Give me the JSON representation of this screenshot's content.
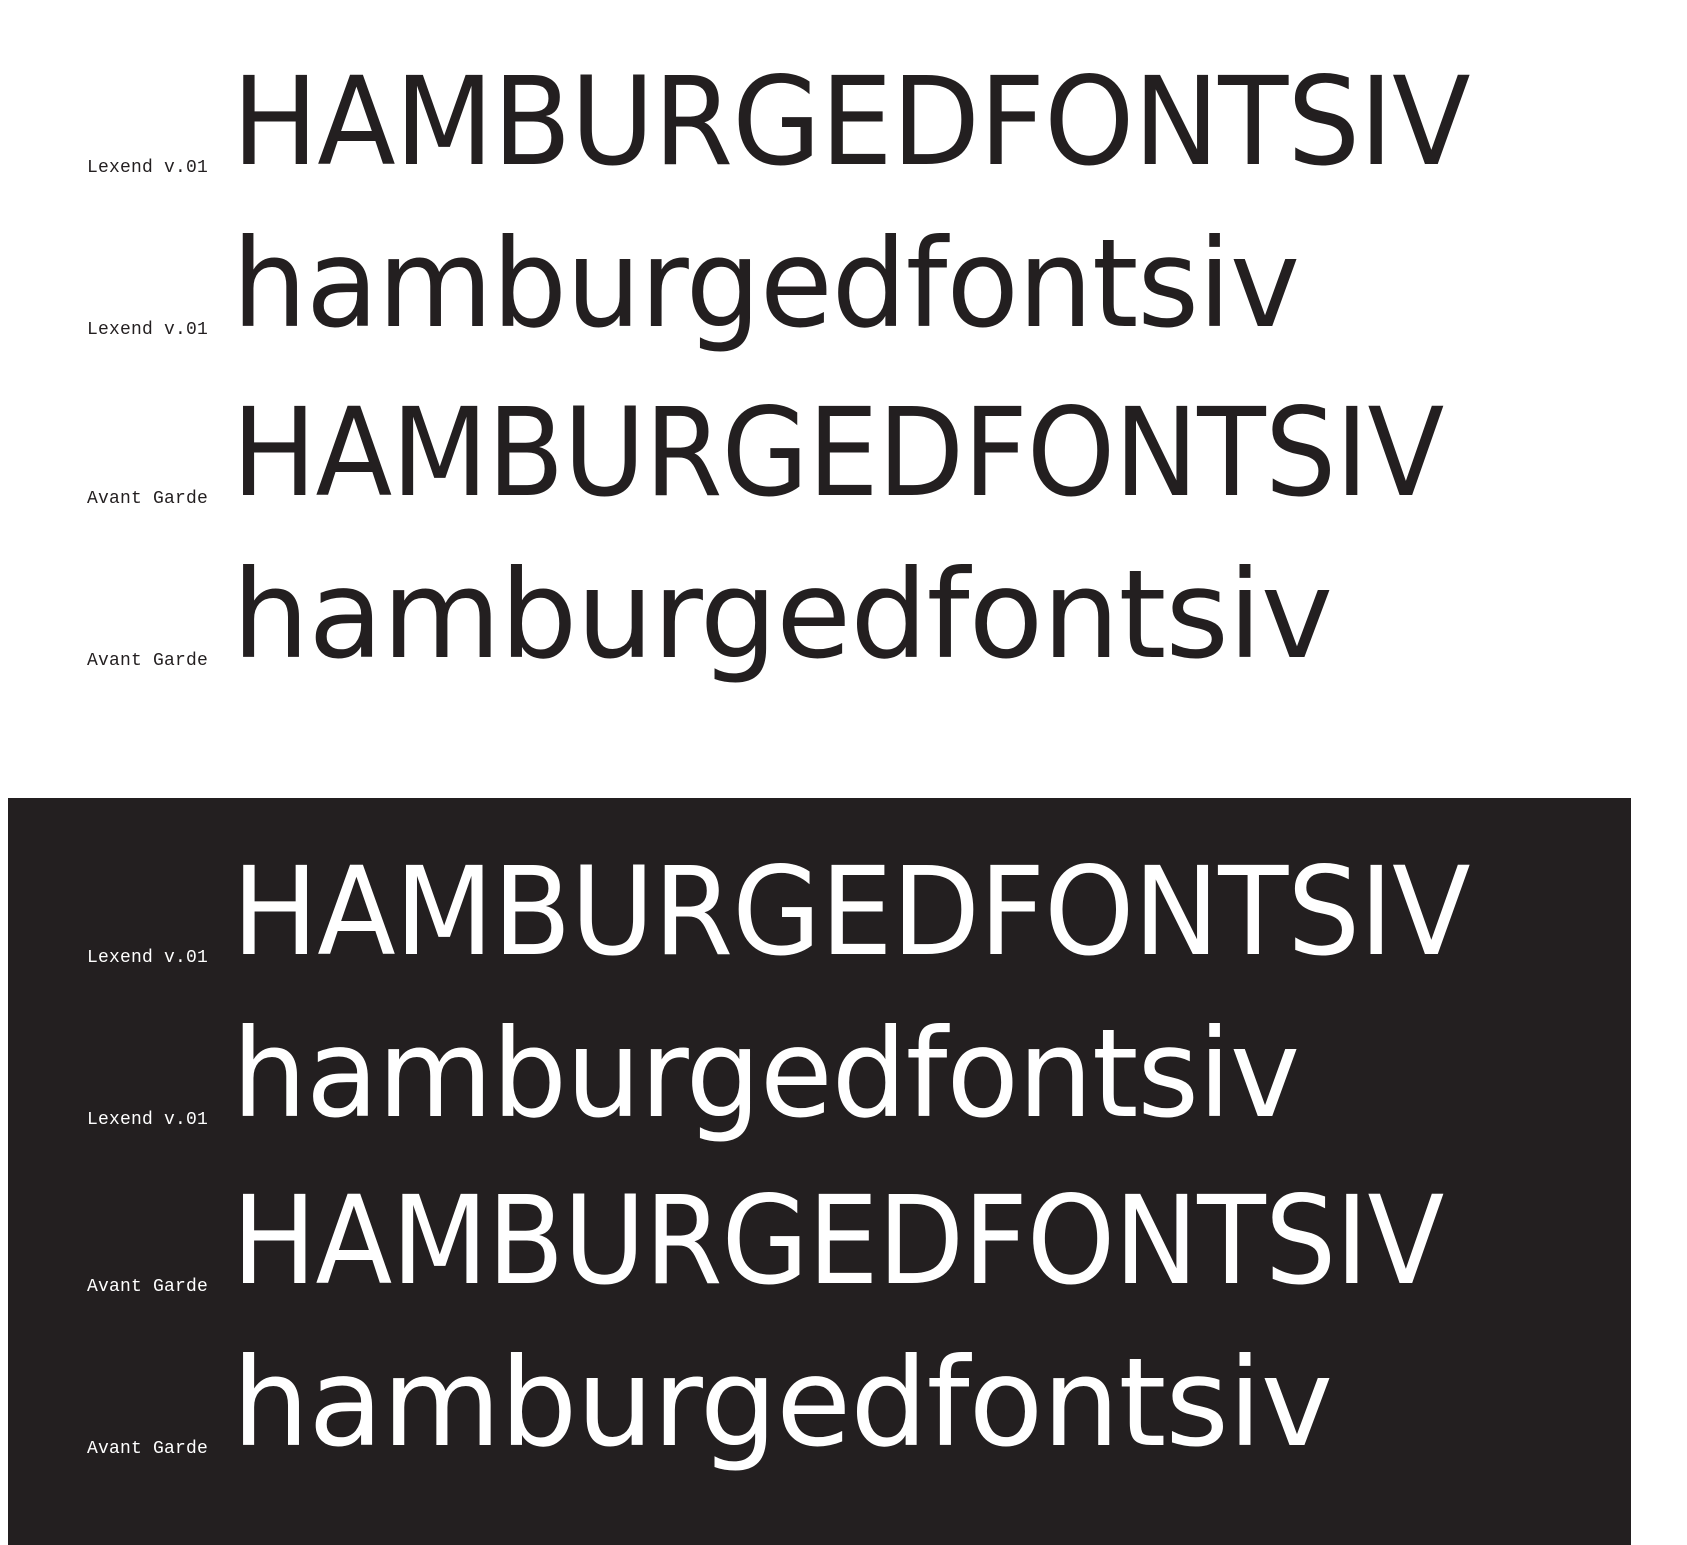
{
  "light_panel": {
    "background": "#ffffff",
    "text_color": "#231f20",
    "rows": [
      {
        "label": "Lexend v.01",
        "specimen": "HAMBURGEDFONTSIV"
      },
      {
        "label": "Lexend v.01",
        "specimen": "hamburgedfontsiv"
      },
      {
        "label": "Avant Garde",
        "specimen": "HAMBURGEDFONTSIV"
      },
      {
        "label": "Avant Garde",
        "specimen": "hamburgedfontsiv"
      }
    ]
  },
  "dark_panel": {
    "background": "#231f20",
    "text_color": "#ffffff",
    "rows": [
      {
        "label": "Lexend v.01",
        "specimen": "HAMBURGEDFONTSIV"
      },
      {
        "label": "Lexend v.01",
        "specimen": "hamburgedfontsiv"
      },
      {
        "label": "Avant Garde",
        "specimen": "HAMBURGEDFONTSIV"
      },
      {
        "label": "Avant Garde",
        "specimen": "hamburgedfontsiv"
      }
    ]
  }
}
